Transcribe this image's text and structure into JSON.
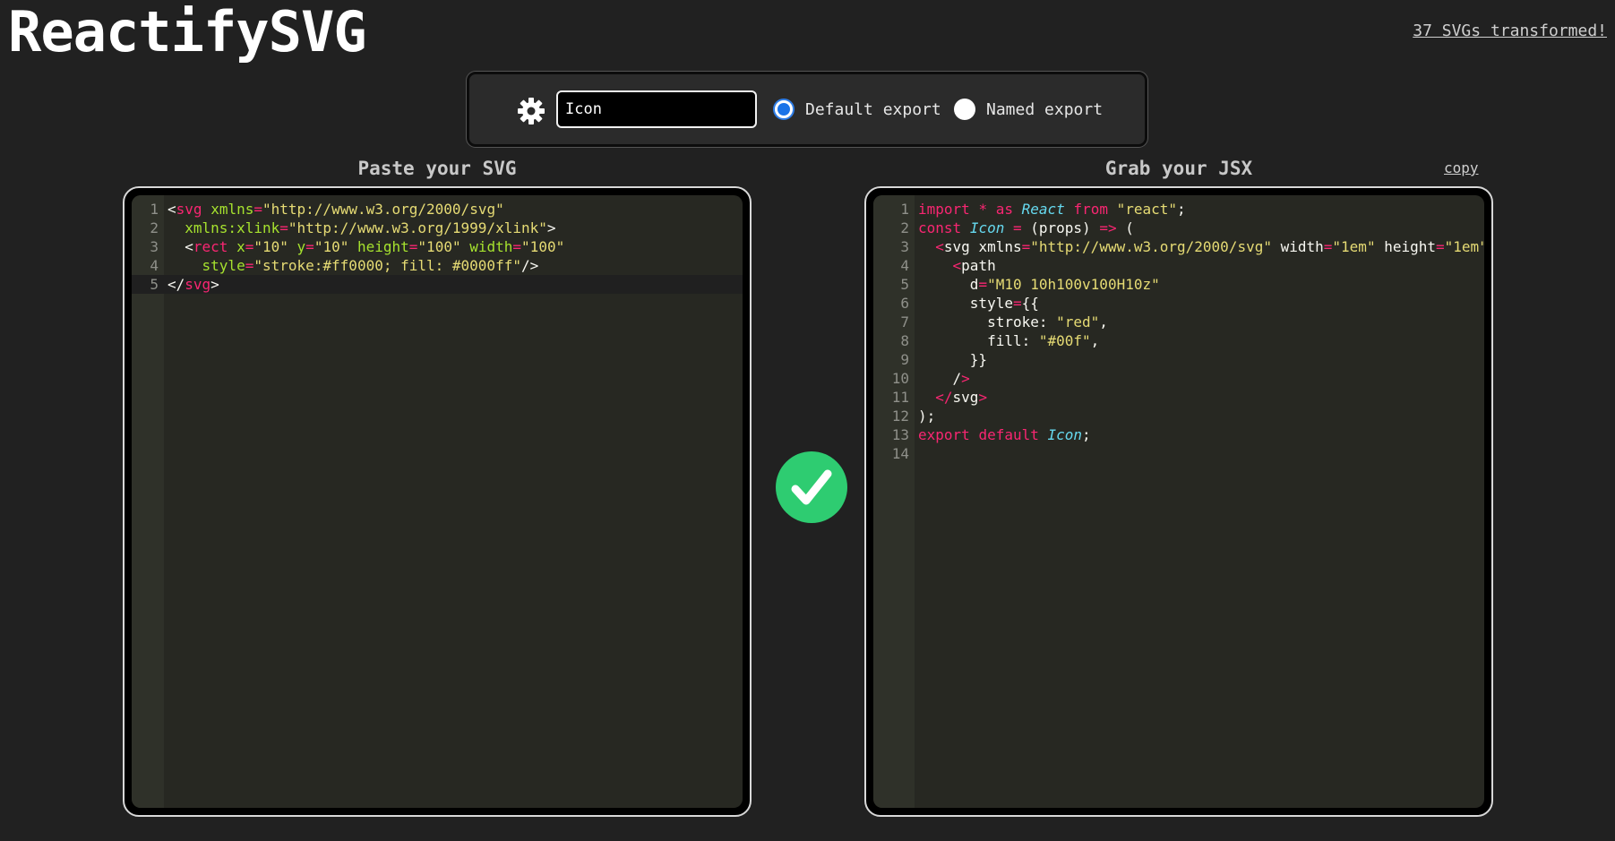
{
  "header": {
    "title": "ReactifySVG",
    "counter": "37 SVGs transformed!"
  },
  "settings": {
    "gear_icon": "gear-icon",
    "component_name_value": "Icon",
    "default_export_label": "Default export",
    "named_export_label": "Named export",
    "selected_export": "default"
  },
  "input_panel": {
    "title": "Paste your SVG",
    "lines": [
      {
        "n": "1",
        "tokens": [
          [
            "tk-plain",
            "<"
          ],
          [
            "tk-tag",
            "svg"
          ],
          [
            "tk-plain",
            " "
          ],
          [
            "tk-attr",
            "xmlns"
          ],
          [
            "tk-op",
            "="
          ],
          [
            "tk-str",
            "\"http://www.w3.org/2000/svg\""
          ]
        ]
      },
      {
        "n": "2",
        "tokens": [
          [
            "tk-plain",
            "  "
          ],
          [
            "tk-attr",
            "xmlns:xlink"
          ],
          [
            "tk-op",
            "="
          ],
          [
            "tk-str",
            "\"http://www.w3.org/1999/xlink\""
          ],
          [
            "tk-plain",
            ">"
          ]
        ]
      },
      {
        "n": "3",
        "tokens": [
          [
            "tk-plain",
            "  <"
          ],
          [
            "tk-tag",
            "rect"
          ],
          [
            "tk-plain",
            " "
          ],
          [
            "tk-attr",
            "x"
          ],
          [
            "tk-op",
            "="
          ],
          [
            "tk-str",
            "\"10\""
          ],
          [
            "tk-plain",
            " "
          ],
          [
            "tk-attr",
            "y"
          ],
          [
            "tk-op",
            "="
          ],
          [
            "tk-str",
            "\"10\""
          ],
          [
            "tk-plain",
            " "
          ],
          [
            "tk-attr",
            "height"
          ],
          [
            "tk-op",
            "="
          ],
          [
            "tk-str",
            "\"100\""
          ],
          [
            "tk-plain",
            " "
          ],
          [
            "tk-attr",
            "width"
          ],
          [
            "tk-op",
            "="
          ],
          [
            "tk-str",
            "\"100\""
          ]
        ]
      },
      {
        "n": "4",
        "tokens": [
          [
            "tk-plain",
            "    "
          ],
          [
            "tk-attr",
            "style"
          ],
          [
            "tk-op",
            "="
          ],
          [
            "tk-str",
            "\"stroke:#ff0000; fill: #0000ff\""
          ],
          [
            "tk-plain",
            "/>"
          ]
        ]
      },
      {
        "n": "5",
        "tokens": [
          [
            "tk-plain",
            "</"
          ],
          [
            "tk-tag",
            "svg"
          ],
          [
            "tk-plain",
            ">"
          ]
        ],
        "active": true
      }
    ]
  },
  "output_panel": {
    "title": "Grab your JSX",
    "copy_label": "copy",
    "lines": [
      {
        "n": "1",
        "tokens": [
          [
            "tk-kw",
            "import"
          ],
          [
            "tk-plain",
            " "
          ],
          [
            "tk-op",
            "*"
          ],
          [
            "tk-plain",
            " "
          ],
          [
            "tk-kw",
            "as"
          ],
          [
            "tk-plain",
            " "
          ],
          [
            "tk-cls",
            "React"
          ],
          [
            "tk-plain",
            " "
          ],
          [
            "tk-kw",
            "from"
          ],
          [
            "tk-plain",
            " "
          ],
          [
            "tk-str",
            "\"react\""
          ],
          [
            "tk-plain",
            ";"
          ]
        ]
      },
      {
        "n": "2",
        "tokens": [
          [
            "tk-kw",
            "const"
          ],
          [
            "tk-plain",
            " "
          ],
          [
            "tk-cls",
            "Icon"
          ],
          [
            "tk-plain",
            " "
          ],
          [
            "tk-op",
            "="
          ],
          [
            "tk-plain",
            " (props) "
          ],
          [
            "tk-op",
            "=>"
          ],
          [
            "tk-plain",
            " ("
          ]
        ]
      },
      {
        "n": "3",
        "tokens": [
          [
            "tk-plain",
            "  "
          ],
          [
            "tk-tag",
            "<"
          ],
          [
            "tk-plain",
            "svg xmlns"
          ],
          [
            "tk-op",
            "="
          ],
          [
            "tk-str",
            "\"http://www.w3.org/2000/svg\""
          ],
          [
            "tk-plain",
            " width"
          ],
          [
            "tk-op",
            "="
          ],
          [
            "tk-str",
            "\"1em\""
          ],
          [
            "tk-plain",
            " height"
          ],
          [
            "tk-op",
            "="
          ],
          [
            "tk-str",
            "\"1em\""
          ]
        ]
      },
      {
        "n": "4",
        "tokens": [
          [
            "tk-plain",
            "    "
          ],
          [
            "tk-tag",
            "<"
          ],
          [
            "tk-plain",
            "path"
          ]
        ]
      },
      {
        "n": "5",
        "tokens": [
          [
            "tk-plain",
            "      d"
          ],
          [
            "tk-op",
            "="
          ],
          [
            "tk-str",
            "\"M10 10h100v100H10z\""
          ]
        ]
      },
      {
        "n": "6",
        "tokens": [
          [
            "tk-plain",
            "      style"
          ],
          [
            "tk-op",
            "="
          ],
          [
            "tk-plain",
            "{{"
          ]
        ]
      },
      {
        "n": "7",
        "tokens": [
          [
            "tk-plain",
            "        stroke: "
          ],
          [
            "tk-str",
            "\"red\""
          ],
          [
            "tk-plain",
            ","
          ]
        ]
      },
      {
        "n": "8",
        "tokens": [
          [
            "tk-plain",
            "        fill: "
          ],
          [
            "tk-str",
            "\"#00f\""
          ],
          [
            "tk-plain",
            ","
          ]
        ]
      },
      {
        "n": "9",
        "tokens": [
          [
            "tk-plain",
            "      }}"
          ]
        ]
      },
      {
        "n": "10",
        "tokens": [
          [
            "tk-plain",
            "    /"
          ],
          [
            "tk-tag",
            ">"
          ]
        ]
      },
      {
        "n": "11",
        "tokens": [
          [
            "tk-plain",
            "  "
          ],
          [
            "tk-tag",
            "</"
          ],
          [
            "tk-plain",
            "svg"
          ],
          [
            "tk-tag",
            ">"
          ]
        ]
      },
      {
        "n": "12",
        "tokens": [
          [
            "tk-plain",
            ");"
          ]
        ]
      },
      {
        "n": "13",
        "tokens": [
          [
            "tk-kw",
            "export"
          ],
          [
            "tk-plain",
            " "
          ],
          [
            "tk-kw",
            "default"
          ],
          [
            "tk-plain",
            " "
          ],
          [
            "tk-cls",
            "Icon"
          ],
          [
            "tk-plain",
            ";"
          ]
        ]
      },
      {
        "n": "14",
        "tokens": []
      }
    ]
  },
  "status": {
    "icon": "check-circle-icon",
    "color": "#2ecc71"
  }
}
